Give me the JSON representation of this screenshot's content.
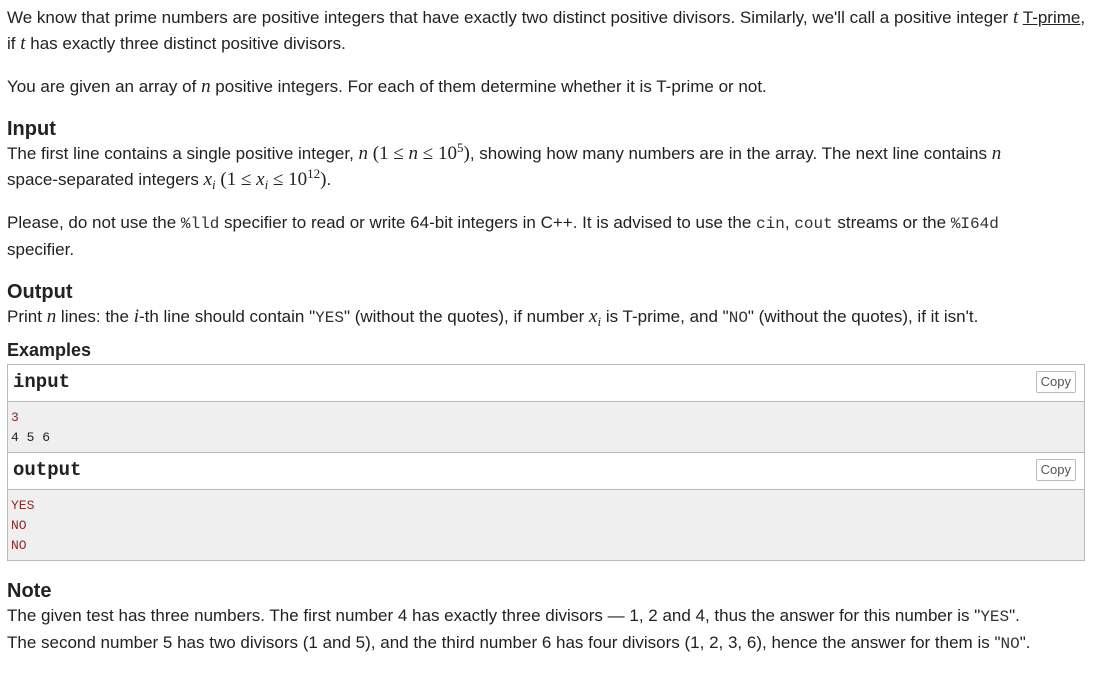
{
  "statement": {
    "p1_a": "We know that prime numbers are positive integers that have exactly two distinct positive divisors. Similarly, we'll call a positive integer ",
    "p1_t": "t",
    "p1_link": "T-prime",
    "p1_b": ", if ",
    "p1_t2": "t",
    "p1_c": " has exactly three distinct positive divisors.",
    "p2_a": "You are given an array of ",
    "p2_n": "n",
    "p2_b": " positive integers. For each of them determine whether it is T-prime or not."
  },
  "input_section": {
    "title": "Input",
    "l1_a": "The first line contains a single positive integer, ",
    "l1_n": "n",
    "l1_range_open": " (1 ≤ ",
    "l1_range_n": "n",
    "l1_range_le": " ≤ 10",
    "l1_exp": "5",
    "l1_range_close": ")",
    "l1_b": ", showing how many numbers are in the array. The next line contains ",
    "l1_n2": "n",
    "l2_a": "space-separated integers ",
    "l2_x": "x",
    "l2_i": "i",
    "l2_range_open": " (1 ≤ ",
    "l2_range_x": "x",
    "l2_range_i": "i",
    "l2_range_le": " ≤ 10",
    "l2_exp": "12",
    "l2_range_close": ")",
    "l2_b": ".",
    "p3_a": "Please, do not use the ",
    "p3_lld": "%lld",
    "p3_b": " specifier to read or write 64-bit integers in C++. It is advised to use the ",
    "p3_cin": "cin",
    "p3_comma": ", ",
    "p3_cout": "cout",
    "p3_c": " streams or the ",
    "p3_i64d": "%I64d",
    "p3_d": "specifier."
  },
  "output_section": {
    "title": "Output",
    "a": "Print ",
    "n": "n",
    "b": " lines: the ",
    "i": "i",
    "c": "-th line should contain \"",
    "yes": "YES",
    "d": "\" (without the quotes), if number ",
    "x": "x",
    "xi": "i",
    "e": " is T-prime, and \"",
    "no": "NO",
    "f": "\" (without the quotes), if it isn't."
  },
  "examples": {
    "title": "Examples",
    "copy_label": "Copy",
    "input": {
      "title": "input",
      "lines": [
        "3",
        "4 5 6"
      ]
    },
    "output": {
      "title": "output",
      "lines": [
        "YES",
        "NO",
        "NO"
      ]
    }
  },
  "note": {
    "title": "Note",
    "l1_a": "The given test has three numbers. The first number 4 has exactly three divisors — 1, 2 and 4, thus the answer for this number is \"",
    "l1_yes": "YES",
    "l1_b": "\".",
    "l2_a": "The second number 5 has two divisors (1 and 5), and the third number 6 has four divisors (1, 2, 3, 6), hence the answer for them is \"",
    "l2_no": "NO",
    "l2_b": "\"."
  }
}
